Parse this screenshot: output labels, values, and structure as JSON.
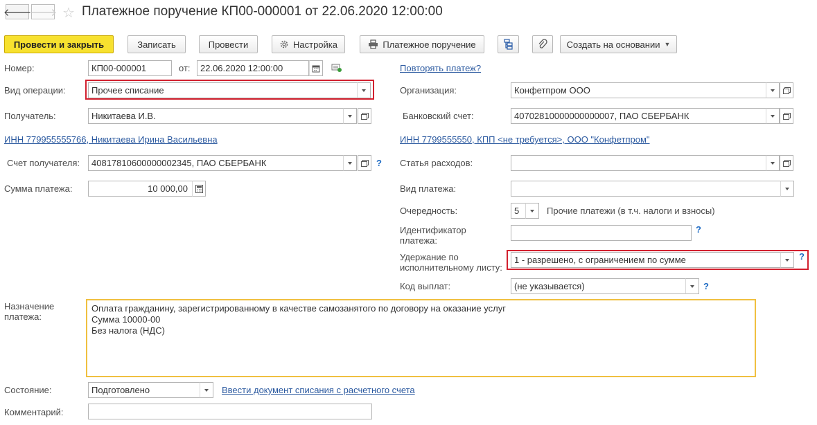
{
  "window": {
    "title": "Платежное поручение КП00-000001 от 22.06.2020 12:00:00"
  },
  "toolbar": {
    "post_close": "Провести и закрыть",
    "save": "Записать",
    "post": "Провести",
    "settings": "Настройка",
    "print_order": "Платежное поручение",
    "create_based": "Создать на основании"
  },
  "form": {
    "number_label": "Номер:",
    "number_value": "КП00-000001",
    "date_label": "от:",
    "date_value": "22.06.2020 12:00:00",
    "repeat_link": "Повторять платеж?",
    "operation_label": "Вид операции:",
    "operation_value": "Прочее списание",
    "org_label": "Организация:",
    "org_value": "Конфетпром ООО",
    "recipient_label": "Получатель:",
    "recipient_value": "Никитаева И.В.",
    "bank_account_label": "Банковский счет:",
    "bank_account_value": "40702810000000000007, ПАО СБЕРБАНК",
    "recipient_inn_link": "ИНН 779955555766, Никитаева Ирина Васильевна",
    "org_inn_link": "ИНН 7799555550, КПП <не требуется>, ООО \"Конфетпром\"",
    "recipient_account_label": "Счет получателя:",
    "recipient_account_value": "40817810600000002345, ПАО СБЕРБАНК",
    "expense_label": "Статья расходов:",
    "expense_value": "",
    "amount_label": "Сумма платежа:",
    "amount_value": "10 000,00",
    "payment_type_label": "Вид платежа:",
    "payment_type_value": "",
    "priority_label": "Очередность:",
    "priority_value": "5",
    "priority_text": "Прочие платежи (в т.ч. налоги и взносы)",
    "payment_id_label": "Идентификатор платежа:",
    "payment_id_value": "",
    "withholding_label": "Удержание по исполнительному листу:",
    "withholding_value": "1 - разрешено, с ограничением по сумме",
    "payout_code_label": "Код выплат:",
    "payout_code_value": "(не указывается)",
    "purpose_label": "Назначение платежа:",
    "purpose_value": "Оплата гражданину, зарегистрированному в качестве самозанятого по договору на оказание услуг\nСумма 10000-00\nБез налога (НДС)",
    "status_label": "Состояние:",
    "status_value": "Подготовлено",
    "status_link": "Ввести документ списания с расчетного счета",
    "comment_label": "Комментарий:",
    "comment_value": "",
    "help_mark": "?"
  },
  "colors": {
    "primary_button": "#f7e12f",
    "highlight": "#d2202e",
    "purpose_border": "#f0c040",
    "link": "#2c5aa0"
  }
}
